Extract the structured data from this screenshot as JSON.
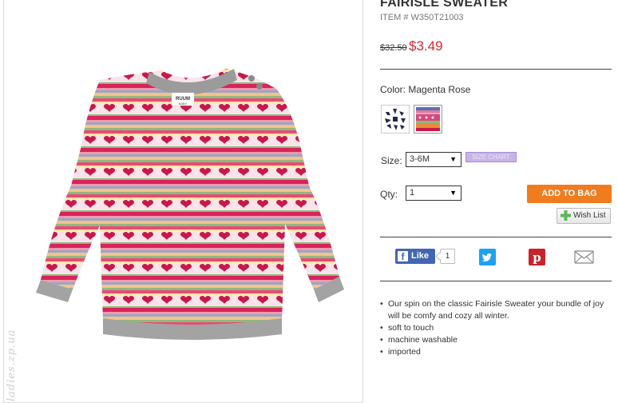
{
  "product": {
    "title": "FAIRISLE SWEATER",
    "item_number": "ITEM # W350T21003",
    "old_price": "$32.50",
    "sale_price": "$3.49"
  },
  "color": {
    "label": "Color: Magenta Rose",
    "swatches": [
      {
        "icon": "navy-snowflake-swatch",
        "color": "#1f2a4a"
      },
      {
        "icon": "magenta-fairisle-swatch",
        "color": "#d9477a",
        "selected": true
      }
    ]
  },
  "size": {
    "label": "Size:",
    "selected": "3-6M",
    "chart_label": "SIZE CHART"
  },
  "qty": {
    "label": "Qty:",
    "selected": "1"
  },
  "actions": {
    "add_to_bag": "ADD TO BAG",
    "wish_list": "Wish List"
  },
  "social": {
    "like_label": "Like",
    "like_count": "1",
    "icons": [
      "facebook-icon",
      "twitter-icon",
      "pinterest-icon",
      "email-icon"
    ]
  },
  "description": [
    "Our spin on the classic Fairisle Sweater your bundle of joy will be comfy and cozy all winter.",
    "soft to touch",
    "machine washable",
    "imported"
  ],
  "image": {
    "tag_brand": "RUUM",
    "tag_sub": "BABY",
    "watermark": "ladies.zp.ua"
  },
  "colors": {
    "sale_red": "#d9262e",
    "button_orange": "#f07c20",
    "facebook_blue": "#4267b2",
    "twitter_blue": "#1da1f2",
    "pinterest_red": "#c8232c"
  }
}
